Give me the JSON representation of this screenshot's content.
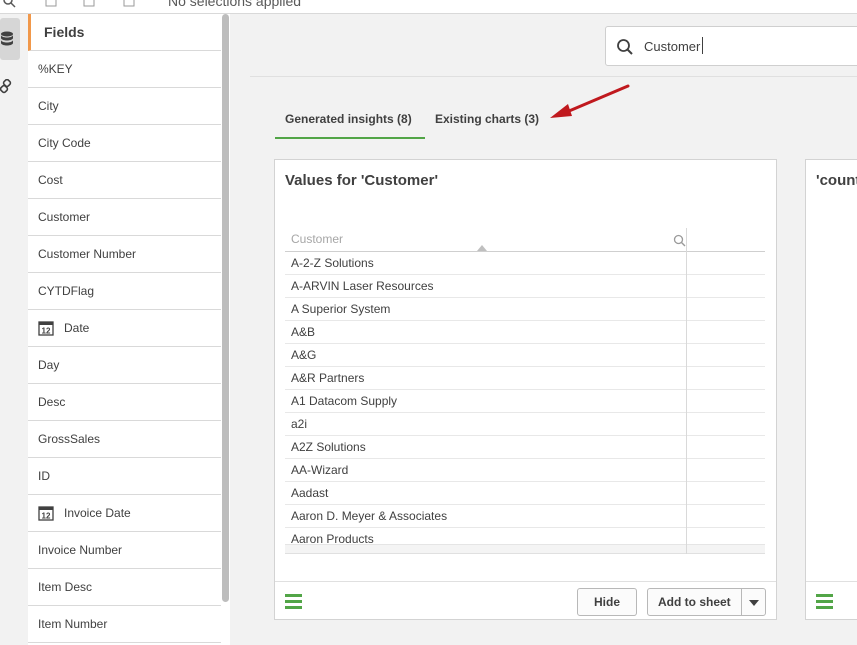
{
  "topbar": {
    "selections_text": "No selections applied"
  },
  "fields_panel": {
    "title": "Fields",
    "items": [
      {
        "label": "%KEY",
        "icon": ""
      },
      {
        "label": "City",
        "icon": ""
      },
      {
        "label": "City Code",
        "icon": ""
      },
      {
        "label": "Cost",
        "icon": ""
      },
      {
        "label": "Customer",
        "icon": ""
      },
      {
        "label": "Customer Number",
        "icon": ""
      },
      {
        "label": "CYTDFlag",
        "icon": ""
      },
      {
        "label": "Date",
        "icon": "calendar-icon"
      },
      {
        "label": "Day",
        "icon": ""
      },
      {
        "label": "Desc",
        "icon": ""
      },
      {
        "label": "GrossSales",
        "icon": ""
      },
      {
        "label": "ID",
        "icon": ""
      },
      {
        "label": "Invoice Date",
        "icon": "calendar-icon"
      },
      {
        "label": "Invoice Number",
        "icon": ""
      },
      {
        "label": "Item Desc",
        "icon": ""
      },
      {
        "label": "Item Number",
        "icon": ""
      }
    ],
    "calendar_day": "12"
  },
  "search": {
    "value": "Customer"
  },
  "tabs": [
    {
      "label": "Generated insights (8)",
      "active": true
    },
    {
      "label": "Existing charts (3)",
      "active": false
    }
  ],
  "card1": {
    "title": "Values for 'Customer'",
    "column_header": "Customer",
    "rows": [
      "A-2-Z Solutions",
      "A-ARVIN Laser Resources",
      "A Superior System",
      "A&B",
      "A&G",
      "A&R Partners",
      "A1 Datacom Supply",
      "a2i",
      "A2Z Solutions",
      "AA-Wizard",
      "Aadast",
      "Aaron D. Meyer & Associates",
      "Aaron Products"
    ],
    "hide_label": "Hide",
    "add_label": "Add to sheet"
  },
  "card2": {
    "title": "'count"
  },
  "colors": {
    "accent_green": "#52a547",
    "accent_orange": "#f1984a",
    "arrow_red": "#c0191e"
  }
}
